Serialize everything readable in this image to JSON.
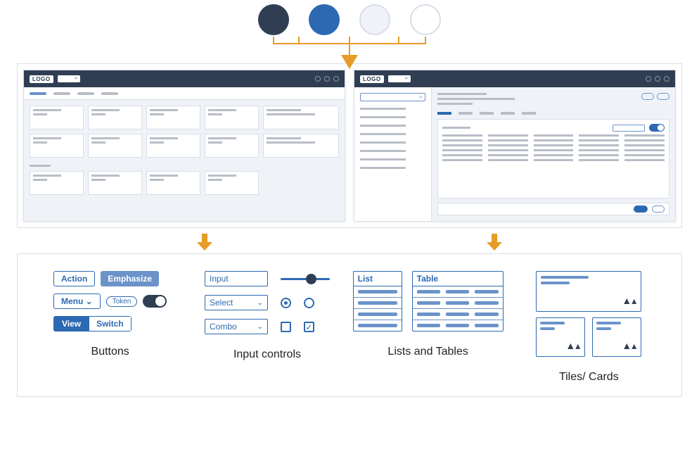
{
  "palette": {
    "colors": [
      "#2F3E52",
      "#2D69B3",
      "#EFF3F8",
      "#FFFFFF"
    ]
  },
  "mockups": {
    "logo_text": "LOGO"
  },
  "components": {
    "buttons": {
      "action_label": "Action",
      "emphasize_label": "Emphasize",
      "menu_label": "Menu",
      "token_label": "Token",
      "view_label": "View",
      "switch_label": "Switch",
      "section_title": "Buttons"
    },
    "inputs": {
      "input_label": "Input",
      "select_label": "Select",
      "combo_label": "Combo",
      "check_mark": "✓",
      "section_title": "Input controls"
    },
    "lists": {
      "list_header": "List",
      "table_header": "Table",
      "section_title": "Lists and Tables"
    },
    "tiles": {
      "section_title": "Tiles/ Cards"
    }
  }
}
